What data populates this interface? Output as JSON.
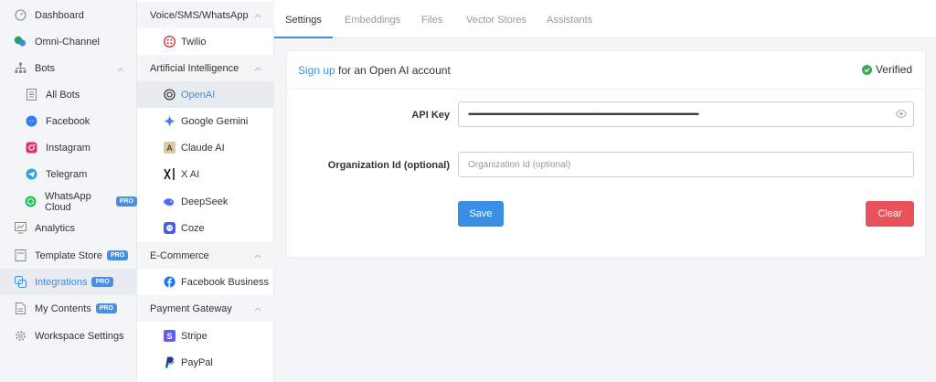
{
  "nav": {
    "items": [
      {
        "label": "Dashboard",
        "icon": "gauge-icon"
      },
      {
        "label": "Omni-Channel",
        "icon": "chat-bubbles-icon"
      },
      {
        "label": "Bots",
        "icon": "sitemap-icon"
      },
      {
        "label": "All Bots",
        "icon": "list-icon"
      },
      {
        "label": "Facebook",
        "icon": "messenger-icon"
      },
      {
        "label": "Instagram",
        "icon": "instagram-icon"
      },
      {
        "label": "Telegram",
        "icon": "telegram-icon"
      },
      {
        "label": "WhatsApp Cloud",
        "icon": "whatsapp-icon",
        "badge": "PRO"
      },
      {
        "label": "Analytics",
        "icon": "analytics-icon"
      },
      {
        "label": "Template Store",
        "icon": "store-icon",
        "badge": "PRO"
      },
      {
        "label": "Integrations",
        "icon": "integrations-icon",
        "badge": "PRO"
      },
      {
        "label": "My Contents",
        "icon": "document-icon",
        "badge": "PRO"
      },
      {
        "label": "Workspace Settings",
        "icon": "gear-icon"
      }
    ]
  },
  "integrations": {
    "sections": [
      {
        "title": "Voice/SMS/WhatsApp",
        "items": [
          {
            "label": "Twilio",
            "icon": "twilio-icon"
          }
        ]
      },
      {
        "title": "Artificial Intelligence",
        "items": [
          {
            "label": "OpenAI",
            "icon": "openai-icon"
          },
          {
            "label": "Google Gemini",
            "icon": "gemini-icon"
          },
          {
            "label": "Claude AI",
            "icon": "claude-icon"
          },
          {
            "label": "X AI",
            "icon": "xai-icon"
          },
          {
            "label": "DeepSeek",
            "icon": "deepseek-icon"
          },
          {
            "label": "Coze",
            "icon": "coze-icon"
          }
        ]
      },
      {
        "title": "E-Commerce",
        "items": [
          {
            "label": "Facebook Business",
            "icon": "facebook-icon"
          }
        ]
      },
      {
        "title": "Payment Gateway",
        "items": [
          {
            "label": "Stripe",
            "icon": "stripe-icon"
          },
          {
            "label": "PayPal",
            "icon": "paypal-icon"
          }
        ]
      }
    ]
  },
  "tabs": [
    "Settings",
    "Embeddings",
    "Files",
    "Vector Stores",
    "Assistants"
  ],
  "card": {
    "signup_link": "Sign up",
    "signup_text": " for an Open AI account",
    "status": "Verified",
    "api_key_label": "API Key",
    "api_key_masked": "••••••••••••••••••••••••••••••••••••••••••••••••••••••••••••••••••••••••••••••••••••••••••••••••••••••••••••••••••••••••••••••••••••••••••••••••••••••••••••••••••",
    "org_label": "Organization Id (optional)",
    "org_placeholder": "Organization Id (optional)",
    "save_label": "Save",
    "clear_label": "Clear"
  },
  "colors": {
    "accent": "#3a8ee6",
    "danger": "#e8535b",
    "verified": "#3aa757"
  }
}
